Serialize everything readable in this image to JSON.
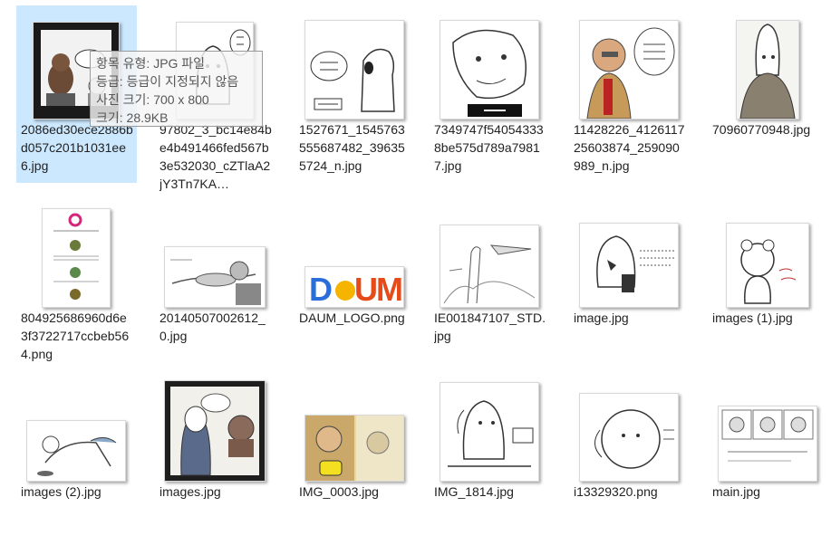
{
  "tooltip": {
    "type_line": "항목 유형: JPG 파일",
    "rating_line": "등급: 등급이 지정되지 않음",
    "dims_line": "사진 크기: 700 x 800",
    "size_line": "크기: 28.9KB"
  },
  "files": [
    {
      "name": "2086ed30ece2886bd057c201b1031ee6.jpg",
      "thumb": "dark-cartoon-icon",
      "selected": true
    },
    {
      "name": "97802_3_bc14e84be4b491466fed567b3e532030_cZTlaA2jY3Tn7KA…",
      "thumb": "ghost-sketch-icon"
    },
    {
      "name": "1527671_1545763555687482_396355724_n.jpg",
      "thumb": "dog-speech-icon"
    },
    {
      "name": "7349747f540543338be575d789a79817.jpg",
      "thumb": "sketch-face-icon"
    },
    {
      "name": "11428226_412611725603874_259090989_n.jpg",
      "thumb": "old-man-comic-icon"
    },
    {
      "name": "70960770948.jpg",
      "thumb": "bald-man-icon"
    },
    {
      "name": "804925686960d6e3f3722717ccbeb564.png",
      "thumb": "document-page-icon"
    },
    {
      "name": "20140507002612_0.jpg",
      "thumb": "flying-man-icon"
    },
    {
      "name": "DAUM_LOGO.png",
      "thumb": "daum-logo-icon"
    },
    {
      "name": "IE001847107_STD.jpg",
      "thumb": "landscape-sketch-icon"
    },
    {
      "name": "image.jpg",
      "thumb": "phone-man-icon"
    },
    {
      "name": "images (1).jpg",
      "thumb": "bear-sketch-icon"
    },
    {
      "name": "images (2).jpg",
      "thumb": "crawling-man-icon"
    },
    {
      "name": "images.jpg",
      "thumb": "alien-cartoon-icon"
    },
    {
      "name": "IMG_0003.jpg",
      "thumb": "yellow-comic-icon"
    },
    {
      "name": "IMG_1814.jpg",
      "thumb": "dog-desk-icon"
    },
    {
      "name": "i13329320.png",
      "thumb": "dog-face-icon"
    },
    {
      "name": "main.jpg",
      "thumb": "comic-strip-icon"
    }
  ]
}
